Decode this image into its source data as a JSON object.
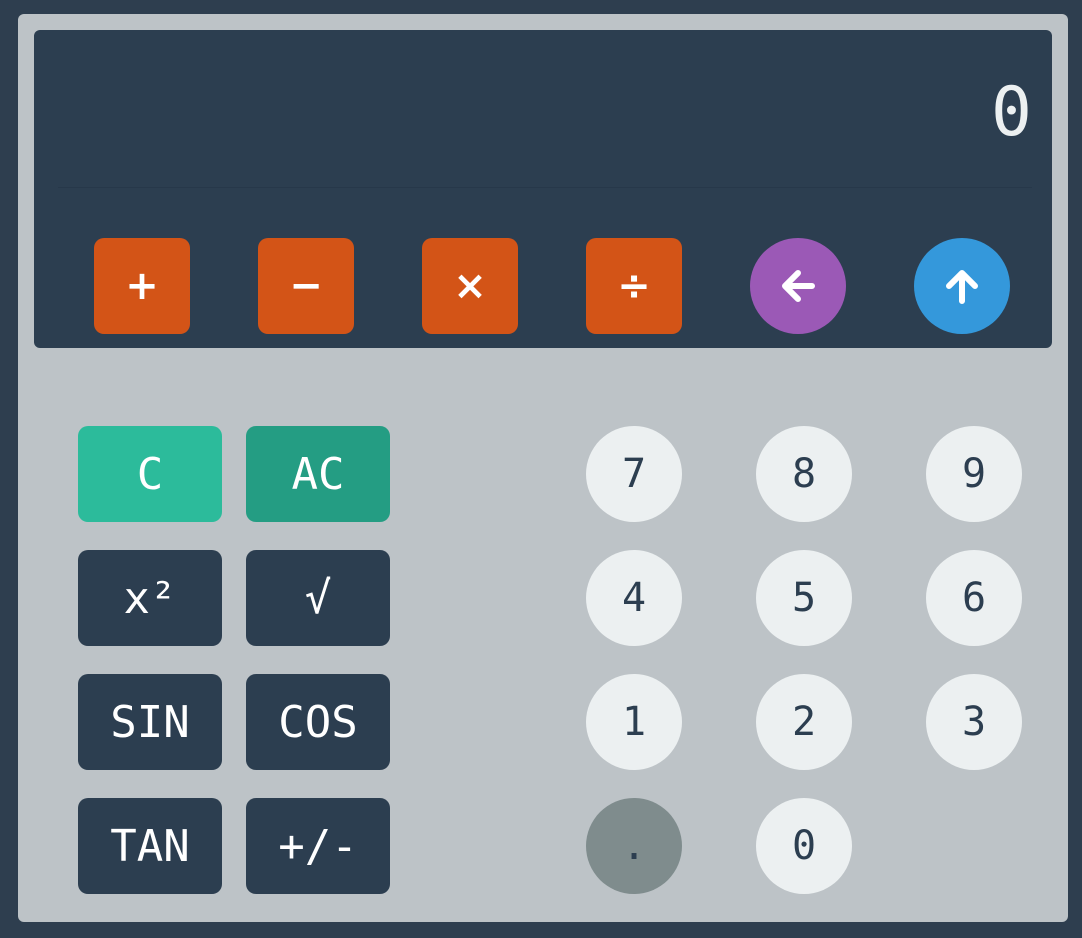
{
  "display": {
    "value": "0"
  },
  "operators": {
    "add": "+",
    "subtract": "−",
    "multiply": "×",
    "divide": "÷",
    "backspace_icon": "arrow-left-icon",
    "recall_icon": "arrow-up-icon"
  },
  "functions": {
    "clear": "C",
    "all_clear": "AC",
    "square": "x²",
    "sqrt": "√",
    "sin": "SIN",
    "cos": "COS",
    "tan": "TAN",
    "negate": "+/-"
  },
  "keypad": {
    "k7": "7",
    "k8": "8",
    "k9": "9",
    "k4": "4",
    "k5": "5",
    "k6": "6",
    "k1": "1",
    "k2": "2",
    "k3": "3",
    "dot": ".",
    "k0": "0"
  },
  "colors": {
    "background": "#2e3e4f",
    "body": "#bdc3c7",
    "screen": "#2c3e50",
    "operator": "#d35417",
    "backspace": "#9b59b6",
    "recall": "#3498db",
    "clear": "#2cbb9b",
    "all_clear": "#249d83",
    "number_key": "#ecf0f1",
    "dot_key": "#7f8c8d"
  }
}
